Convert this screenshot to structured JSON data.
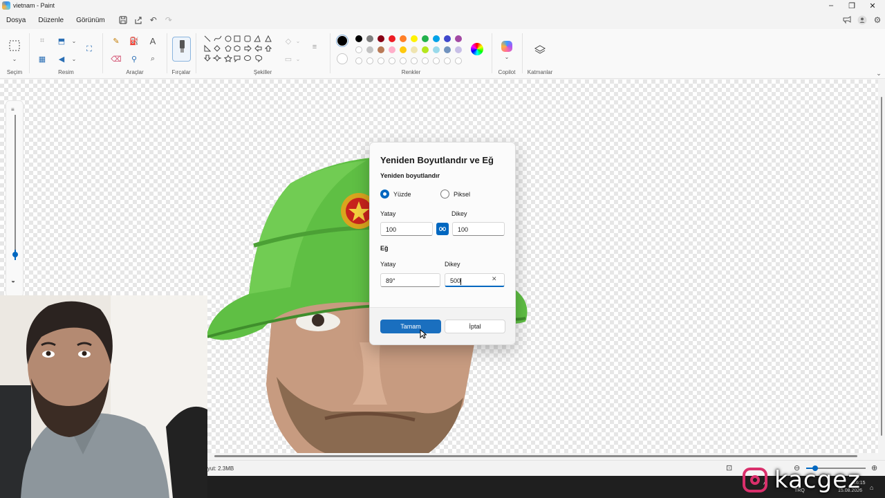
{
  "window": {
    "title": "vietnam - Paint"
  },
  "menu": {
    "items": [
      "Dosya",
      "Düzenle",
      "Görünüm"
    ]
  },
  "ribbon": {
    "groups": {
      "selection": "Seçim",
      "image": "Resim",
      "tools": "Araçlar",
      "brushes": "Fırçalar",
      "shapes": "Şekiller",
      "colors": "Renkler",
      "copilot": "Copilot",
      "layers": "Katmanlar"
    }
  },
  "palette": {
    "row1": [
      "#000000",
      "#7f7f7f",
      "#880015",
      "#ed1c24",
      "#ff7f27",
      "#fff200",
      "#22b14c",
      "#00a2e8",
      "#3f48cc",
      "#a349a4"
    ],
    "row2": [
      "",
      "#c3c3c3",
      "#b97a57",
      "#ffaec9",
      "#ffc90e",
      "#efe4b0",
      "#b5e61d",
      "#99d9ea",
      "#7092be",
      "#c8bfe7"
    ],
    "primary": "#000000"
  },
  "dialog": {
    "title": "Yeniden Boyutlandır ve Eğ",
    "resize_heading": "Yeniden boyutlandır",
    "by_percent": "Yüzde",
    "by_pixel": "Piksel",
    "resize_h_label": "Yatay",
    "resize_v_label": "Dikey",
    "resize_h_value": "100",
    "resize_v_value": "100",
    "skew_heading": "Eğ",
    "skew_h_label": "Yatay",
    "skew_v_label": "Dikey",
    "skew_h_value": "89°",
    "skew_v_value": "500",
    "ok": "Tamam",
    "cancel": "İptal"
  },
  "status": {
    "size_text": "yut: 2.3MB"
  },
  "taskbar": {
    "lang": "TRQ",
    "time": "16:15",
    "date": "15.08.2026"
  },
  "watermark": {
    "text": "kacgez"
  },
  "accent": "#0067c0"
}
